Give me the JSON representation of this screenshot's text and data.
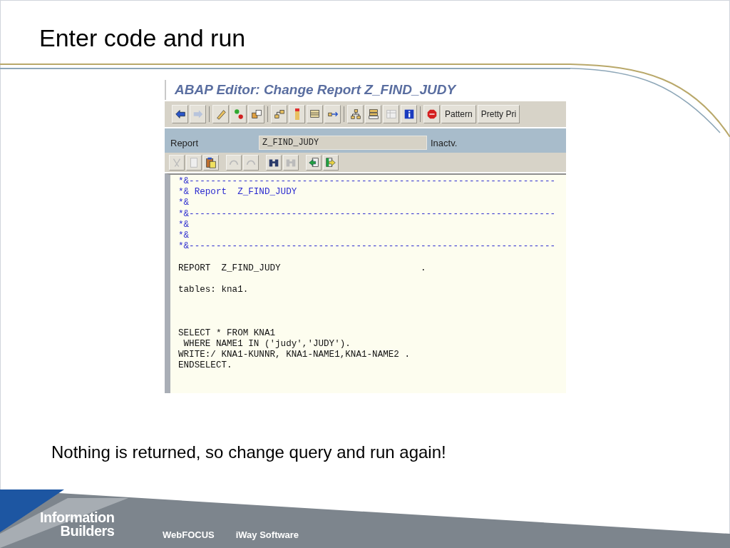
{
  "slide": {
    "title": "Enter code and run",
    "caption": "Nothing is returned, so change query and run again!"
  },
  "editor": {
    "title": "ABAP Editor: Change Report Z_FIND_JUDY",
    "text_buttons": [
      "Pattern",
      "Pretty Pri"
    ],
    "report_label": "Report",
    "report_value": "Z_FIND_JUDY",
    "status": "Inactv.",
    "code_lines": [
      {
        "kind": "comment",
        "text": "*&--------------------------------------------------------------------"
      },
      {
        "kind": "comment",
        "text": "*& Report  Z_FIND_JUDY"
      },
      {
        "kind": "comment",
        "text": "*&"
      },
      {
        "kind": "comment",
        "text": "*&--------------------------------------------------------------------"
      },
      {
        "kind": "comment",
        "text": "*&"
      },
      {
        "kind": "comment",
        "text": "*&"
      },
      {
        "kind": "comment",
        "text": "*&--------------------------------------------------------------------"
      },
      {
        "kind": "blank"
      },
      {
        "kind": "code",
        "text": "REPORT  Z_FIND_JUDY                          ."
      },
      {
        "kind": "blank"
      },
      {
        "kind": "code",
        "text": "tables: kna1."
      },
      {
        "kind": "blank"
      },
      {
        "kind": "blank"
      },
      {
        "kind": "blank"
      },
      {
        "kind": "code",
        "text": "SELECT * FROM KNA1"
      },
      {
        "kind": "code",
        "text": " WHERE NAME1 IN ('judy','JUDY')."
      },
      {
        "kind": "code",
        "text": "WRITE:/ KNA1-KUNNR, KNA1-NAME1,KNA1-NAME2 ."
      },
      {
        "kind": "code",
        "text": "ENDSELECT."
      }
    ]
  },
  "footer": {
    "logo_lines": [
      "Information",
      "Builders"
    ],
    "products": [
      "WebFOCUS",
      "iWay Software"
    ]
  }
}
